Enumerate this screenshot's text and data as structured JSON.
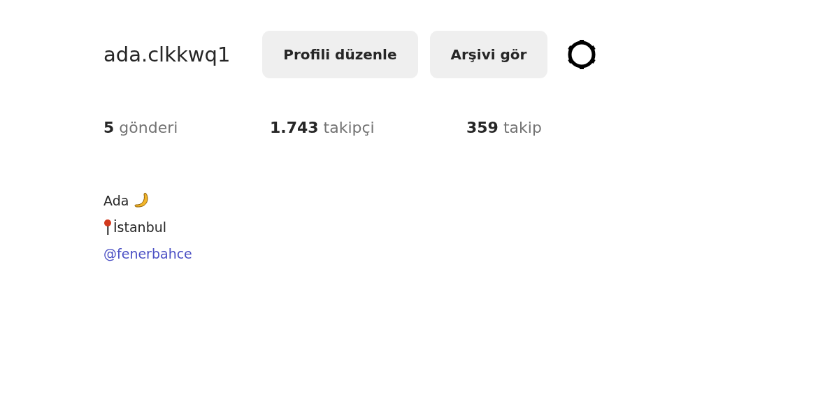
{
  "profile": {
    "username": "ada.clkkwq1",
    "buttons": [
      "Profili düzenle",
      "Arşivi gör"
    ]
  },
  "stats": [
    {
      "count": "5",
      "label": "gönderi"
    },
    {
      "count": "1.743",
      "label": "takipçi"
    },
    {
      "count": "359",
      "label": "takip"
    }
  ],
  "bio": {
    "name": "Ada",
    "location": "İstanbul",
    "link": "@fenerbahce"
  }
}
